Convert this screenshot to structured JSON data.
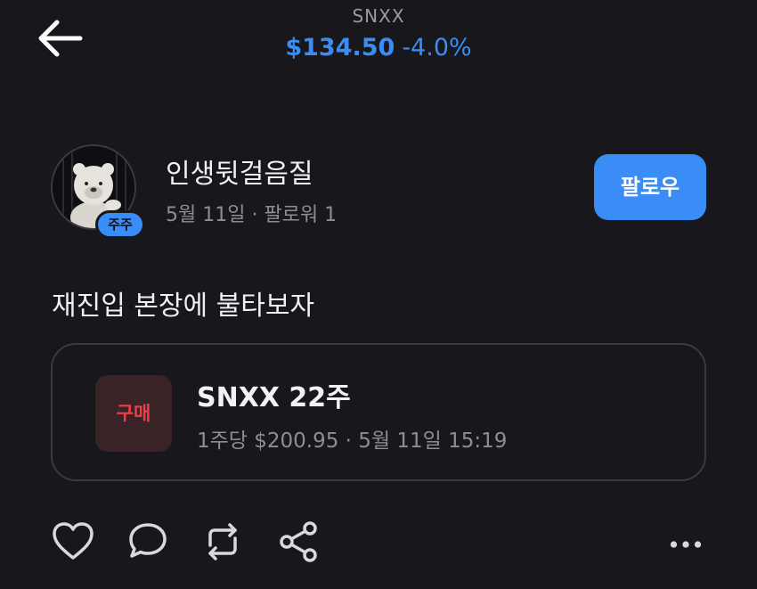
{
  "header": {
    "ticker": "SNXX",
    "price": "$134.50",
    "change": "-4.0%"
  },
  "author": {
    "name": "인생뒷걸음질",
    "meta": "5월 11일 · 팔로워 1",
    "badge": "주주"
  },
  "follow_button": {
    "label": "팔로우"
  },
  "post": {
    "text": "재진입 본장에 불타보자"
  },
  "trade": {
    "type_label": "구매",
    "title": "SNXX 22주",
    "detail": "1주당 $200.95 · 5월 11일 15:19"
  },
  "icons": {
    "back": "back-arrow-icon",
    "like": "heart-icon",
    "comment": "comment-bubble-icon",
    "repost": "repost-icon",
    "share": "share-icon",
    "more": "more-dots-icon"
  },
  "colors": {
    "background": "#17171c",
    "accent": "#3a8cf6",
    "buy_red": "#f03e46"
  }
}
